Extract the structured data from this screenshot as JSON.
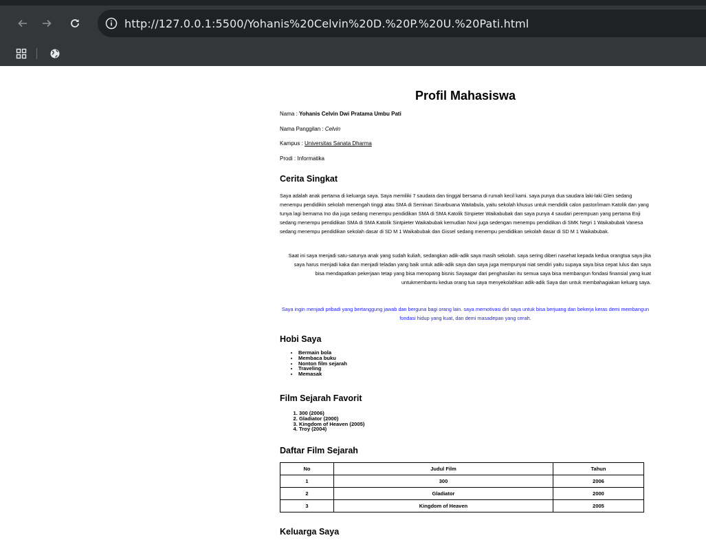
{
  "browser": {
    "url": "http://127.0.0.1:5500/Yohanis%20Celvin%20D.%20P.%20U.%20Pati.html"
  },
  "page": {
    "title": "Profil Mahasiswa",
    "info": {
      "nama_label": "Nama : ",
      "nama_value": "Yohanis Celvin Dwi Pratama Umbu Pati",
      "panggilan_label": "Nama Panggilan : ",
      "panggilan_value": "Celvin",
      "kampus_label": "Kampus : ",
      "kampus_value": "Universitas Sanata Dharma",
      "prodi_label": "Prodi : ",
      "prodi_value": "Informatika"
    },
    "cerita": {
      "heading": "Cerita Singkat",
      "p1": "Saya adalah anak pertama di keluarga saya. Saya memiliki 7 saudara dan tinggal bersama di rumah kecil kami. saya punya dua saudara laki-laki Glen sedang menempu pendidikin sekolah menengah tinggi atau SMA di Seminari Sinarbuana Waitabula, yaitu sekolah khusus untuk mendidik calon pastor/imam Katolik dan yang tunya lagi bernama Ino dia juga sedang menempu pendidikan SMA di SMA Katolik SInpieter Waikabubak dan saya punya 4 saudari perempuan yang pertama Enji sedang menempu pendidikan SMA di SMA Katolik Sintpieter Waikabubak kemudian Novi juga sedengan menempu pendidikan di SMK Negri 1 Waikabubak Vanesa sedang menempu pendidikan sekolah dasar di SD M 1 Waikabubak dan Gissel sedang menempu pendidikan sekolah dasar di SD M 1 Waikabubak.",
      "p2": "Saat ini saya menjadi satu-satunya anak yang sudah kuliah, sedangkan adik-adik saya masih sekolah. saya sering diberi nasehat kepada kedua orangtua saya jika saya harus menjadi kaka dan menjadi teladan yang baik untuk adik-adik saya dan saya juga mempunyai niat sendiri yaitu supaya saya bisa cepat lulus dan saya bisa mendapatkan pekerjaan tetap yang bisa menopang bisnis Sayaagar dari penghasilan itu semua saya bisa membangun fondasi finansial yang kuat untukmembantu kedua orang tua saya menyekolahkan adik-adik Saya dan untuk membahagiakan keluarg saya.",
      "p3": "Saya ingin menjadi pribadi yang bertanggung jawab dan berguna bagi orang lain. saya memotivasi diri saya untuk bisa berjuang dan bekerja keras demi membangun fondasi hidup yang kuat, dan demi masadepan yang cerah."
    },
    "hobi": {
      "heading": "Hobi Saya",
      "items": [
        "Bermain bola",
        "Membaca buku",
        "Nonton film sejarah",
        "Traveling",
        "Memasak"
      ]
    },
    "film_favorit": {
      "heading": "Film Sejarah Favorit",
      "items": [
        "300 (2006)",
        "Gladiator (2000)",
        "Kingdom of Heaven (2005)",
        "Troy (2004)"
      ]
    },
    "daftar_film": {
      "heading": "Daftar Film Sejarah",
      "columns": [
        "No",
        "Judul Film",
        "Tahun"
      ],
      "rows": [
        [
          "1",
          "300",
          "2006"
        ],
        [
          "2",
          "Gladiator",
          "2000"
        ],
        [
          "3",
          "Kingdom of Heaven",
          "2005"
        ]
      ]
    },
    "keluarga": {
      "heading": "Keluarga Saya"
    }
  }
}
